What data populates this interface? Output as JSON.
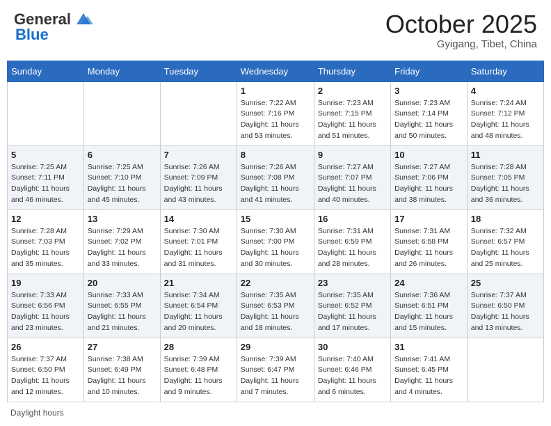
{
  "header": {
    "logo_general": "General",
    "logo_blue": "Blue",
    "month": "October 2025",
    "location": "Gyigang, Tibet, China"
  },
  "days_of_week": [
    "Sunday",
    "Monday",
    "Tuesday",
    "Wednesday",
    "Thursday",
    "Friday",
    "Saturday"
  ],
  "weeks": [
    [
      {
        "day": "",
        "sunrise": "",
        "sunset": "",
        "daylight": ""
      },
      {
        "day": "",
        "sunrise": "",
        "sunset": "",
        "daylight": ""
      },
      {
        "day": "",
        "sunrise": "",
        "sunset": "",
        "daylight": ""
      },
      {
        "day": "1",
        "sunrise": "Sunrise: 7:22 AM",
        "sunset": "Sunset: 7:16 PM",
        "daylight": "Daylight: 11 hours and 53 minutes."
      },
      {
        "day": "2",
        "sunrise": "Sunrise: 7:23 AM",
        "sunset": "Sunset: 7:15 PM",
        "daylight": "Daylight: 11 hours and 51 minutes."
      },
      {
        "day": "3",
        "sunrise": "Sunrise: 7:23 AM",
        "sunset": "Sunset: 7:14 PM",
        "daylight": "Daylight: 11 hours and 50 minutes."
      },
      {
        "day": "4",
        "sunrise": "Sunrise: 7:24 AM",
        "sunset": "Sunset: 7:12 PM",
        "daylight": "Daylight: 11 hours and 48 minutes."
      }
    ],
    [
      {
        "day": "5",
        "sunrise": "Sunrise: 7:25 AM",
        "sunset": "Sunset: 7:11 PM",
        "daylight": "Daylight: 11 hours and 46 minutes."
      },
      {
        "day": "6",
        "sunrise": "Sunrise: 7:25 AM",
        "sunset": "Sunset: 7:10 PM",
        "daylight": "Daylight: 11 hours and 45 minutes."
      },
      {
        "day": "7",
        "sunrise": "Sunrise: 7:26 AM",
        "sunset": "Sunset: 7:09 PM",
        "daylight": "Daylight: 11 hours and 43 minutes."
      },
      {
        "day": "8",
        "sunrise": "Sunrise: 7:26 AM",
        "sunset": "Sunset: 7:08 PM",
        "daylight": "Daylight: 11 hours and 41 minutes."
      },
      {
        "day": "9",
        "sunrise": "Sunrise: 7:27 AM",
        "sunset": "Sunset: 7:07 PM",
        "daylight": "Daylight: 11 hours and 40 minutes."
      },
      {
        "day": "10",
        "sunrise": "Sunrise: 7:27 AM",
        "sunset": "Sunset: 7:06 PM",
        "daylight": "Daylight: 11 hours and 38 minutes."
      },
      {
        "day": "11",
        "sunrise": "Sunrise: 7:28 AM",
        "sunset": "Sunset: 7:05 PM",
        "daylight": "Daylight: 11 hours and 36 minutes."
      }
    ],
    [
      {
        "day": "12",
        "sunrise": "Sunrise: 7:28 AM",
        "sunset": "Sunset: 7:03 PM",
        "daylight": "Daylight: 11 hours and 35 minutes."
      },
      {
        "day": "13",
        "sunrise": "Sunrise: 7:29 AM",
        "sunset": "Sunset: 7:02 PM",
        "daylight": "Daylight: 11 hours and 33 minutes."
      },
      {
        "day": "14",
        "sunrise": "Sunrise: 7:30 AM",
        "sunset": "Sunset: 7:01 PM",
        "daylight": "Daylight: 11 hours and 31 minutes."
      },
      {
        "day": "15",
        "sunrise": "Sunrise: 7:30 AM",
        "sunset": "Sunset: 7:00 PM",
        "daylight": "Daylight: 11 hours and 30 minutes."
      },
      {
        "day": "16",
        "sunrise": "Sunrise: 7:31 AM",
        "sunset": "Sunset: 6:59 PM",
        "daylight": "Daylight: 11 hours and 28 minutes."
      },
      {
        "day": "17",
        "sunrise": "Sunrise: 7:31 AM",
        "sunset": "Sunset: 6:58 PM",
        "daylight": "Daylight: 11 hours and 26 minutes."
      },
      {
        "day": "18",
        "sunrise": "Sunrise: 7:32 AM",
        "sunset": "Sunset: 6:57 PM",
        "daylight": "Daylight: 11 hours and 25 minutes."
      }
    ],
    [
      {
        "day": "19",
        "sunrise": "Sunrise: 7:33 AM",
        "sunset": "Sunset: 6:56 PM",
        "daylight": "Daylight: 11 hours and 23 minutes."
      },
      {
        "day": "20",
        "sunrise": "Sunrise: 7:33 AM",
        "sunset": "Sunset: 6:55 PM",
        "daylight": "Daylight: 11 hours and 21 minutes."
      },
      {
        "day": "21",
        "sunrise": "Sunrise: 7:34 AM",
        "sunset": "Sunset: 6:54 PM",
        "daylight": "Daylight: 11 hours and 20 minutes."
      },
      {
        "day": "22",
        "sunrise": "Sunrise: 7:35 AM",
        "sunset": "Sunset: 6:53 PM",
        "daylight": "Daylight: 11 hours and 18 minutes."
      },
      {
        "day": "23",
        "sunrise": "Sunrise: 7:35 AM",
        "sunset": "Sunset: 6:52 PM",
        "daylight": "Daylight: 11 hours and 17 minutes."
      },
      {
        "day": "24",
        "sunrise": "Sunrise: 7:36 AM",
        "sunset": "Sunset: 6:51 PM",
        "daylight": "Daylight: 11 hours and 15 minutes."
      },
      {
        "day": "25",
        "sunrise": "Sunrise: 7:37 AM",
        "sunset": "Sunset: 6:50 PM",
        "daylight": "Daylight: 11 hours and 13 minutes."
      }
    ],
    [
      {
        "day": "26",
        "sunrise": "Sunrise: 7:37 AM",
        "sunset": "Sunset: 6:50 PM",
        "daylight": "Daylight: 11 hours and 12 minutes."
      },
      {
        "day": "27",
        "sunrise": "Sunrise: 7:38 AM",
        "sunset": "Sunset: 6:49 PM",
        "daylight": "Daylight: 11 hours and 10 minutes."
      },
      {
        "day": "28",
        "sunrise": "Sunrise: 7:39 AM",
        "sunset": "Sunset: 6:48 PM",
        "daylight": "Daylight: 11 hours and 9 minutes."
      },
      {
        "day": "29",
        "sunrise": "Sunrise: 7:39 AM",
        "sunset": "Sunset: 6:47 PM",
        "daylight": "Daylight: 11 hours and 7 minutes."
      },
      {
        "day": "30",
        "sunrise": "Sunrise: 7:40 AM",
        "sunset": "Sunset: 6:46 PM",
        "daylight": "Daylight: 11 hours and 6 minutes."
      },
      {
        "day": "31",
        "sunrise": "Sunrise: 7:41 AM",
        "sunset": "Sunset: 6:45 PM",
        "daylight": "Daylight: 11 hours and 4 minutes."
      },
      {
        "day": "",
        "sunrise": "",
        "sunset": "",
        "daylight": ""
      }
    ]
  ],
  "footer": "Daylight hours"
}
